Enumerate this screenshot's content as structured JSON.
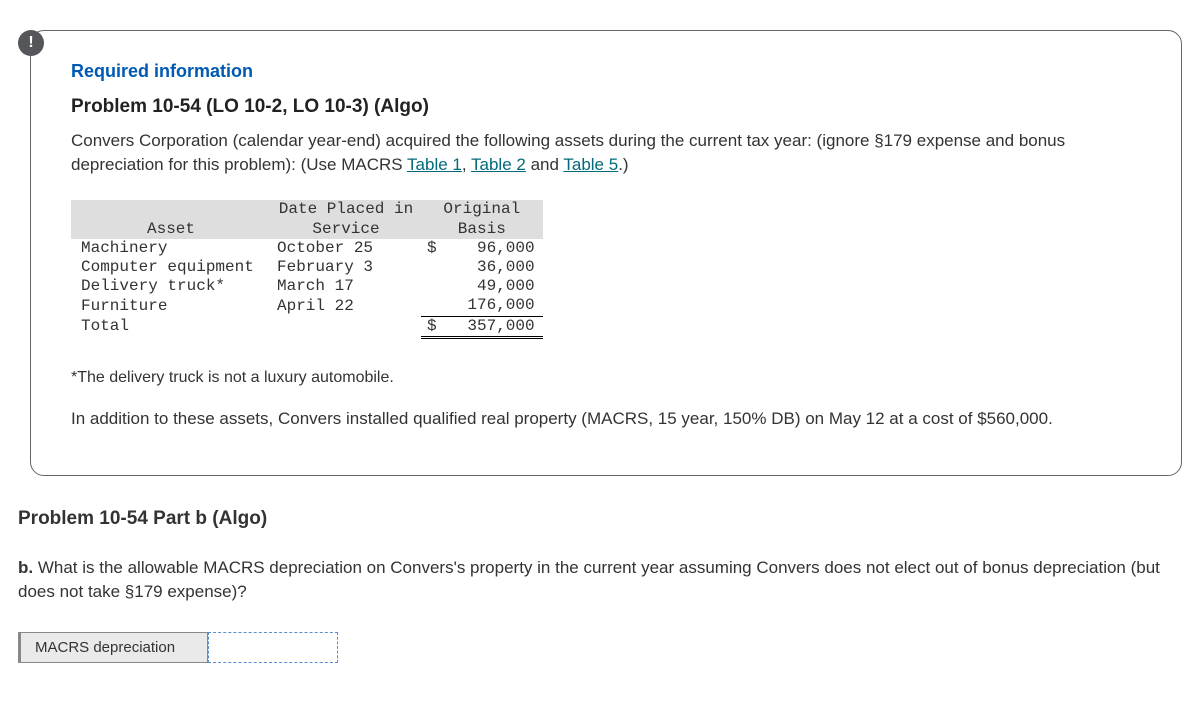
{
  "badge": "!",
  "header": {
    "required": "Required information",
    "title": "Problem 10-54 (LO 10-2, LO 10-3) (Algo)",
    "intro_a": "Convers Corporation (calendar year-end) acquired the following assets during the current tax year: (ignore §179 expense and bonus depreciation for this problem): (Use MACRS ",
    "link1": "Table 1",
    "sep1": ", ",
    "link2": "Table 2",
    "sep2": " and ",
    "link3": "Table 5",
    "intro_b": ".)"
  },
  "table": {
    "col_asset": "Asset",
    "col_date_l1": "Date Placed in",
    "col_date_l2": "Service",
    "col_basis_l1": "Original",
    "col_basis_l2": "Basis",
    "rows": [
      {
        "asset": "Machinery",
        "date": "October 25",
        "cur": "$",
        "basis": "96,000"
      },
      {
        "asset": "Computer equipment",
        "date": "February 3",
        "cur": "",
        "basis": "36,000"
      },
      {
        "asset": "Delivery truck*",
        "date": "March 17",
        "cur": "",
        "basis": "49,000"
      },
      {
        "asset": "Furniture",
        "date": "April 22",
        "cur": "",
        "basis": "176,000"
      }
    ],
    "total_label": "Total",
    "total_cur": "$",
    "total_basis": "357,000"
  },
  "footnote": "*The delivery truck is not a luxury automobile.",
  "additional": "In addition to these assets, Convers installed qualified real property (MACRS, 15 year, 150% DB) on May 12 at a cost of $560,000.",
  "partb_title": "Problem 10-54 Part b (Algo)",
  "partb_q_prefix": "b.",
  "partb_q_body": " What is the allowable MACRS depreciation on Convers's property in the current year assuming Convers does not elect out of bonus depreciation (but does not take §179 expense)?",
  "answer_label": "MACRS depreciation",
  "answer_placeholder": ""
}
